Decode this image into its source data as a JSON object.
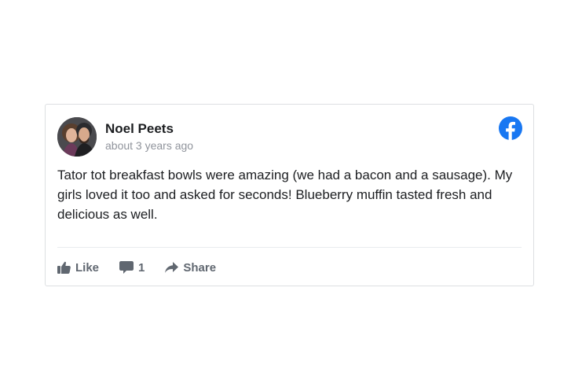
{
  "post": {
    "author": "Noel Peets",
    "timestamp": "about 3 years ago",
    "text": "Tator tot breakfast bowls were amazing (we had a bacon and a sausage). My girls loved it too and asked for seconds! Blueberry muffin tasted fresh and delicious as well.",
    "source_icon": "facebook-icon",
    "avatar_icon": "avatar"
  },
  "actions": {
    "like_label": "Like",
    "comment_count": "1",
    "share_label": "Share"
  },
  "colors": {
    "facebook_blue": "#1877f2",
    "action_gray": "#606770",
    "timestamp_gray": "#90949c",
    "text": "#1c1e21",
    "border": "#dddfe2"
  }
}
